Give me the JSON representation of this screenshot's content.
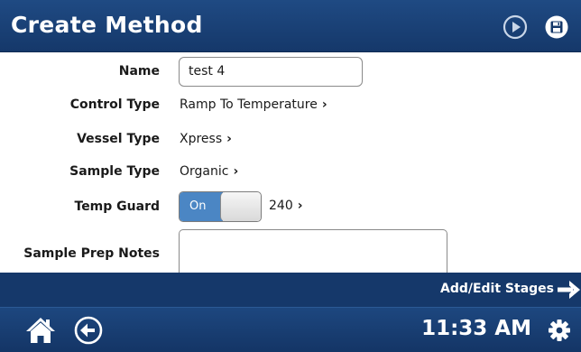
{
  "header": {
    "title": "Create Method",
    "icons": [
      "play-icon",
      "save-icon"
    ]
  },
  "form": {
    "name": {
      "label": "Name",
      "value": "test 4"
    },
    "control_type": {
      "label": "Control Type",
      "value": "Ramp To Temperature"
    },
    "vessel_type": {
      "label": "Vessel Type",
      "value": "Xpress"
    },
    "sample_type": {
      "label": "Sample Type",
      "value": "Organic"
    },
    "temp_guard": {
      "label": "Temp Guard",
      "toggle_label": "On",
      "state": "on",
      "value": "240"
    },
    "sample_prep_notes": {
      "label": "Sample Prep Notes",
      "value": ""
    }
  },
  "stage_bar": {
    "label": "Add/Edit Stages",
    "icon": "arrow-right-icon"
  },
  "footer": {
    "time": "11:33 AM",
    "icons": [
      "home-icon",
      "back-icon",
      "gear-icon"
    ]
  },
  "colors": {
    "header_bg": "#1f4a83",
    "footer_bg": "#15386a",
    "toggle_on": "#4b86c4"
  }
}
